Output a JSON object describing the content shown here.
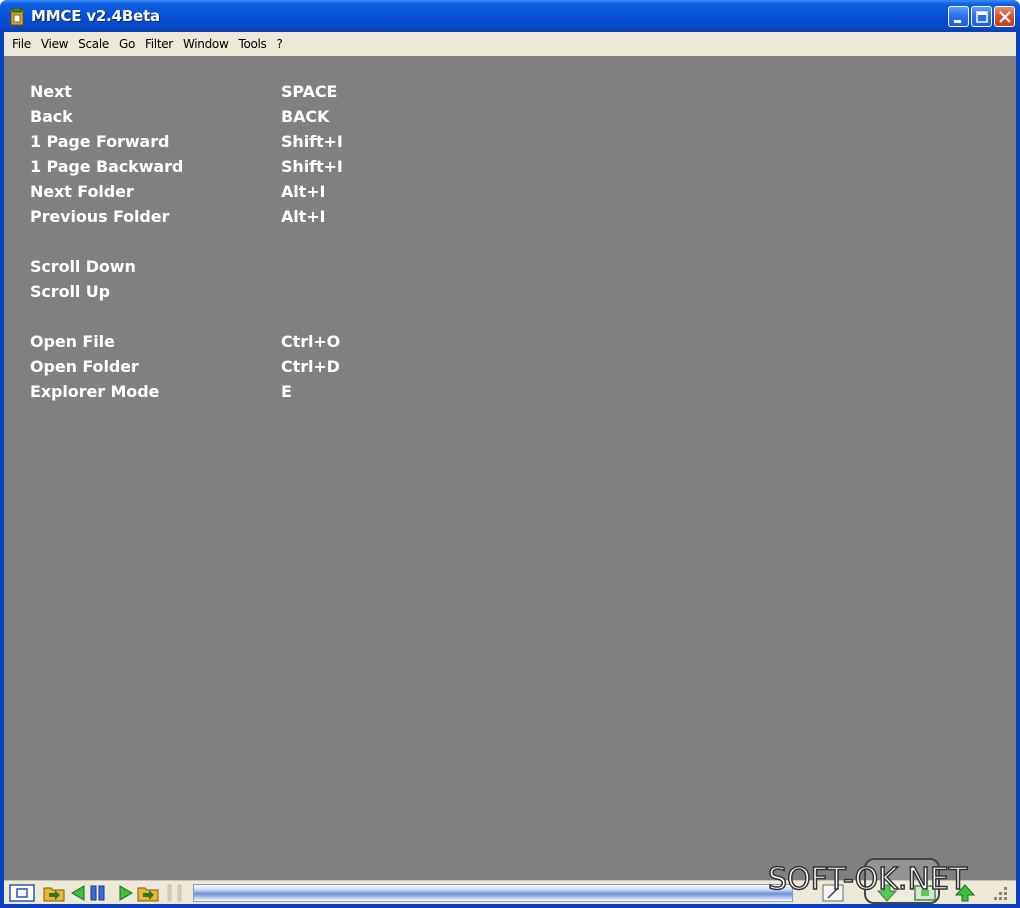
{
  "window": {
    "title": "MMCE v2.4Beta",
    "titlebar_color": "#0850d6"
  },
  "menubar": {
    "items": [
      "File",
      "View",
      "Scale",
      "Go",
      "Filter",
      "Window",
      "Tools",
      "?"
    ]
  },
  "shortcuts": [
    {
      "label": "Next",
      "key": "SPACE"
    },
    {
      "label": "Back",
      "key": "BACK"
    },
    {
      "label": "1 Page Forward",
      "key": "Shift+I"
    },
    {
      "label": "1 Page Backward",
      "key": "Shift+I"
    },
    {
      "label": "Next Folder",
      "key": "Alt+I"
    },
    {
      "label": "Previous Folder",
      "key": "Alt+I"
    },
    {
      "label": "Scroll Down",
      "key": ""
    },
    {
      "label": "Scroll Up",
      "key": ""
    },
    {
      "label": "Open File",
      "key": "Ctrl+O"
    },
    {
      "label": "Open Folder",
      "key": "Ctrl+D"
    },
    {
      "label": "Explorer Mode",
      "key": "E"
    }
  ],
  "statusbar": {
    "icons": [
      "view-mode-icon",
      "open-folder-icon",
      "back-arrow-icon",
      "pause-icon",
      "forward-arrow-icon",
      "next-folder-icon",
      "grip-icon",
      "slider-track",
      "page-icon",
      "green-arrow-down-icon",
      "green-arrow-up-icon",
      "fit-icon",
      "resize-grip-icon"
    ]
  },
  "watermark": {
    "text": "SOFT-OK.NET"
  },
  "colors": {
    "content_bg": "#808080",
    "menu_bg": "#ece9d8",
    "text": "#ffffff"
  }
}
